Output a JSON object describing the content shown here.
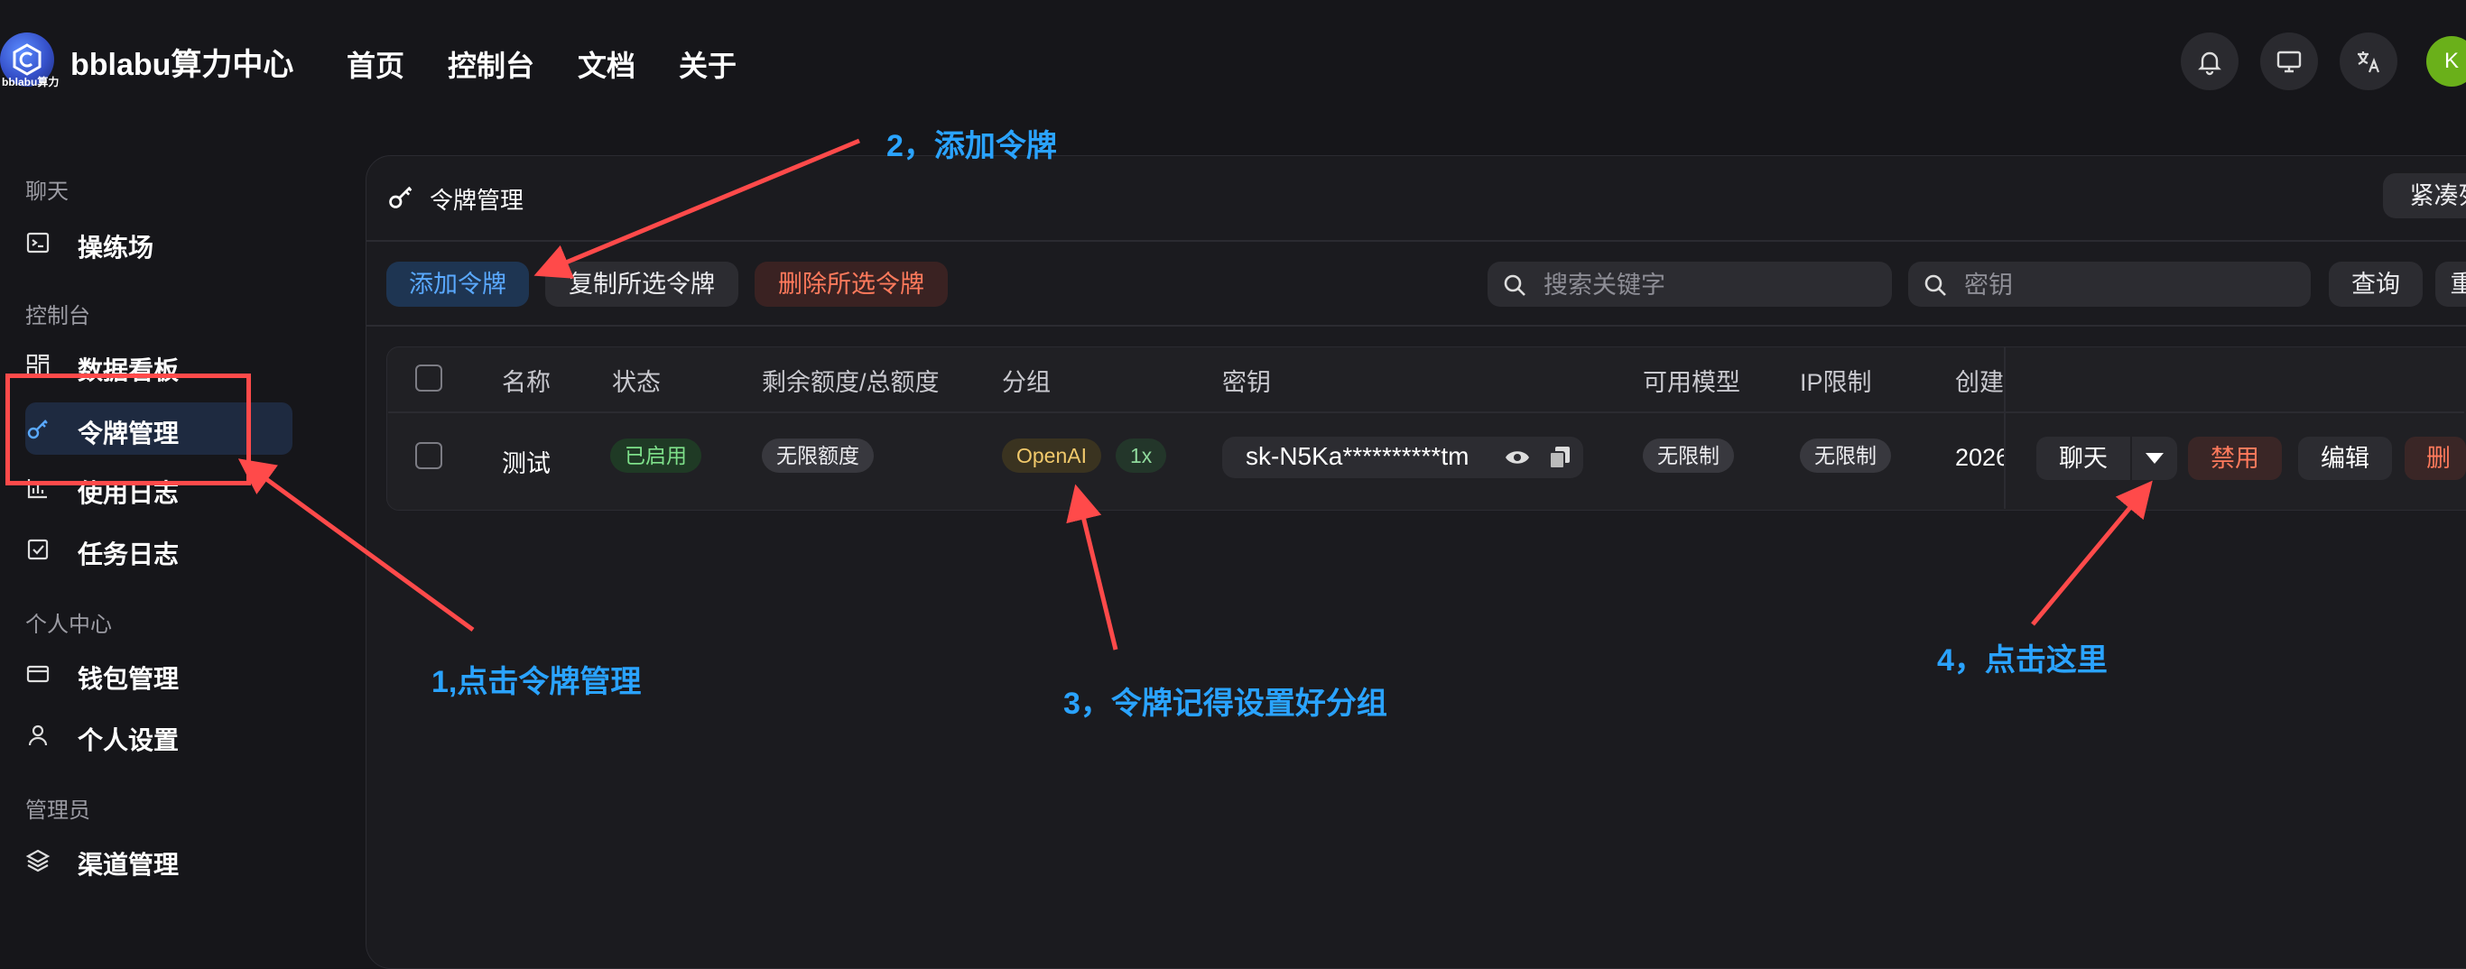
{
  "header": {
    "logo_text": "bblabu算力",
    "brand": "bblabu算力中心",
    "nav": [
      "首页",
      "控制台",
      "文档",
      "关于"
    ],
    "avatar_letter": "K"
  },
  "sidebar": {
    "sections": [
      {
        "title": "聊天",
        "items": [
          {
            "label": "操练场",
            "icon": "terminal-icon"
          }
        ]
      },
      {
        "title": "控制台",
        "items": [
          {
            "label": "数据看板",
            "icon": "dashboard-icon"
          },
          {
            "label": "令牌管理",
            "icon": "key-icon",
            "active": true
          },
          {
            "label": "使用日志",
            "icon": "chart-icon"
          },
          {
            "label": "任务日志",
            "icon": "checklist-icon"
          }
        ]
      },
      {
        "title": "个人中心",
        "items": [
          {
            "label": "钱包管理",
            "icon": "wallet-icon"
          },
          {
            "label": "个人设置",
            "icon": "user-icon"
          }
        ]
      },
      {
        "title": "管理员",
        "items": [
          {
            "label": "渠道管理",
            "icon": "layers-icon"
          }
        ]
      }
    ]
  },
  "panel": {
    "title": "令牌管理",
    "compact_button": "紧凑列",
    "add_button": "添加令牌",
    "copy_button": "复制所选令牌",
    "delete_button": "删除所选令牌",
    "search_keyword_placeholder": "搜索关键字",
    "search_key_placeholder": "密钥",
    "query_button": "查询",
    "reset_button": "重"
  },
  "table": {
    "columns": [
      "名称",
      "状态",
      "剩余额度/总额度",
      "分组",
      "密钥",
      "可用模型",
      "IP限制",
      "创建"
    ],
    "rows": [
      {
        "name": "测试",
        "status": "已启用",
        "quota": "无限额度",
        "group": "OpenAI",
        "ratio": "1x",
        "key": "sk-N5Ka**********tm",
        "models": "无限制",
        "ip": "无限制",
        "created": "2026",
        "actions": {
          "chat": "聊天",
          "disable": "禁用",
          "edit": "编辑",
          "delete": "删除"
        }
      }
    ]
  },
  "annotations": {
    "step1": "1,点击令牌管理",
    "step2": "2，添加令牌",
    "step3": "3，令牌记得设置好分组",
    "step4": "4，点击这里"
  },
  "colors": {
    "accent": "#2aa3ff",
    "annotation_red": "#ff4a4a",
    "background": "#16161a"
  }
}
